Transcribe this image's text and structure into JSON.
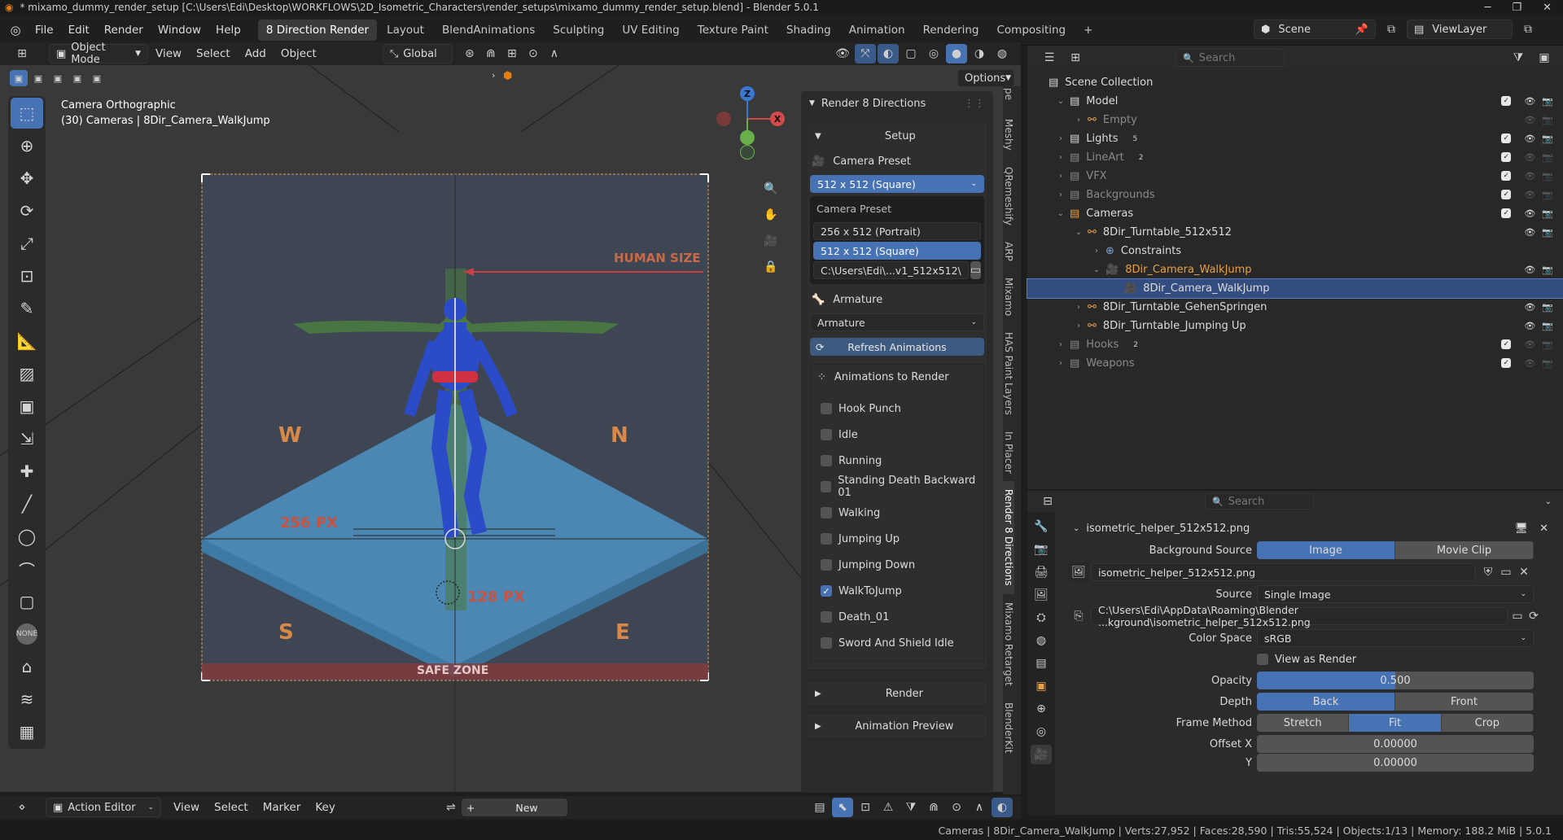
{
  "window": {
    "title": "* mixamo_dummy_render_setup [C:\\Users\\Edi\\Desktop\\WORKFLOWS\\2D_Isometric_Characters\\render_setups\\mixamo_dummy_render_setup.blend] - Blender 5.0.1"
  },
  "menus": [
    "File",
    "Edit",
    "Render",
    "Window",
    "Help"
  ],
  "workspaces": [
    "8 Direction Render",
    "Layout",
    "BlendAnimations",
    "Sculpting",
    "UV Editing",
    "Texture Paint",
    "Shading",
    "Animation",
    "Rendering",
    "Compositing"
  ],
  "scene": {
    "name": "Scene",
    "view_layer": "ViewLayer"
  },
  "viewport_header": {
    "mode": "Object Mode",
    "menus": [
      "View",
      "Select",
      "Add",
      "Object"
    ],
    "orientation": "Global",
    "options": "Options"
  },
  "viewport": {
    "camera_label": "Camera Orthographic",
    "object_label": "(30) Cameras | 8Dir_Camera_WalkJump",
    "overlay_texts": {
      "human_size": "HUMAN SIZE",
      "w": "W",
      "n": "N",
      "s": "S",
      "e": "E",
      "px256": "256 PX",
      "px128": "128 PX",
      "safe_zone": "SAFE ZONE"
    },
    "axis": {
      "x": "X",
      "y": "Y",
      "z": "Z"
    }
  },
  "npanel": {
    "title": "Render 8 Directions",
    "setup": "Setup",
    "camera_preset_label": "Camera Preset",
    "camera_preset_value": "512 x 512  (Square)",
    "dropdown_header": "Camera Preset",
    "preset_options": [
      "256 x 512  (Portrait)",
      "512 x 512  (Square)"
    ],
    "path": "C:\\Users\\Edi\\...v1_512x512\\",
    "armature_label": "Armature",
    "armature_value": "Armature",
    "refresh": "Refresh Animations",
    "animations_title": "Animations to Render",
    "animations": [
      {
        "name": "Hook Punch",
        "checked": false
      },
      {
        "name": "Idle",
        "checked": false
      },
      {
        "name": "Running",
        "checked": false
      },
      {
        "name": "Standing Death Backward 01",
        "checked": false
      },
      {
        "name": "Walking",
        "checked": false
      },
      {
        "name": "Jumping Up",
        "checked": false
      },
      {
        "name": "Jumping Down",
        "checked": false
      },
      {
        "name": "WalkToJump",
        "checked": true
      },
      {
        "name": "Death_01",
        "checked": false
      },
      {
        "name": "Sword And Shield Idle",
        "checked": false
      }
    ],
    "render": "Render",
    "animation_preview": "Animation Preview",
    "tabs": [
      "Meshy",
      "QRemeshify",
      "ARP",
      "Mixamo",
      "HAS Paint Layers",
      "In Placer",
      "Render 8 Directions",
      "Mixamo Retarget",
      "BlenderKit"
    ]
  },
  "outliner": {
    "search_placeholder": "Search",
    "root": "Scene Collection",
    "rows": [
      {
        "label": "Model",
        "indent": 1
      },
      {
        "label": "Empty",
        "indent": 2,
        "dim": true
      },
      {
        "label": "Lights",
        "indent": 1,
        "badge": "5"
      },
      {
        "label": "LineArt",
        "indent": 1,
        "dim": true,
        "badge": "2"
      },
      {
        "label": "VFX",
        "indent": 1,
        "dim": true
      },
      {
        "label": "Backgrounds",
        "indent": 1,
        "dim": true
      },
      {
        "label": "Cameras",
        "indent": 1
      },
      {
        "label": "8Dir_Turntable_512x512",
        "indent": 2
      },
      {
        "label": "Constraints",
        "indent": 3
      },
      {
        "label": "8Dir_Camera_WalkJump",
        "indent": 3,
        "highlight": true
      },
      {
        "label": "8Dir_Camera_WalkJump",
        "indent": 4,
        "selected": true
      },
      {
        "label": "8Dir_Turntable_GehenSpringen",
        "indent": 2
      },
      {
        "label": "8Dir_Turntable_Jumping Up",
        "indent": 2
      },
      {
        "label": "Hooks",
        "indent": 1,
        "dim": true,
        "badge": "2"
      },
      {
        "label": "Weapons",
        "indent": 1,
        "dim": true
      }
    ]
  },
  "properties": {
    "search_placeholder": "Search",
    "image_name": "isometric_helper_512x512.png",
    "background_source_label": "Background Source",
    "background_source": [
      "Image",
      "Movie Clip"
    ],
    "image_field": "isometric_helper_512x512.png",
    "source_label": "Source",
    "source_value": "Single Image",
    "filepath": "C:\\Users\\Edi\\AppData\\Roaming\\Blender ...kground\\isometric_helper_512x512.png",
    "color_space_label": "Color Space",
    "color_space": "sRGB",
    "view_as_render": "View as Render",
    "opacity_label": "Opacity",
    "opacity": "0.500",
    "depth_label": "Depth",
    "depth": [
      "Back",
      "Front"
    ],
    "frame_method_label": "Frame Method",
    "frame_method": [
      "Stretch",
      "Fit",
      "Crop"
    ],
    "offset_x_label": "Offset X",
    "offset_x": "0.00000",
    "offset_y_label": "Y",
    "offset_y": "0.00000"
  },
  "timeline": {
    "editor": "Action Editor",
    "menus": [
      "View",
      "Select",
      "Marker",
      "Key"
    ],
    "new": "New"
  },
  "status": "Cameras | 8Dir_Camera_WalkJump | Verts:27,952 | Faces:28,590 | Tris:55,524 | Objects:1/13 | Memory: 188.2 MiB | 5.0.1",
  "colors": {
    "accent": "#4772b3",
    "selection": "#334d80",
    "orange_text": "#e8a045"
  }
}
